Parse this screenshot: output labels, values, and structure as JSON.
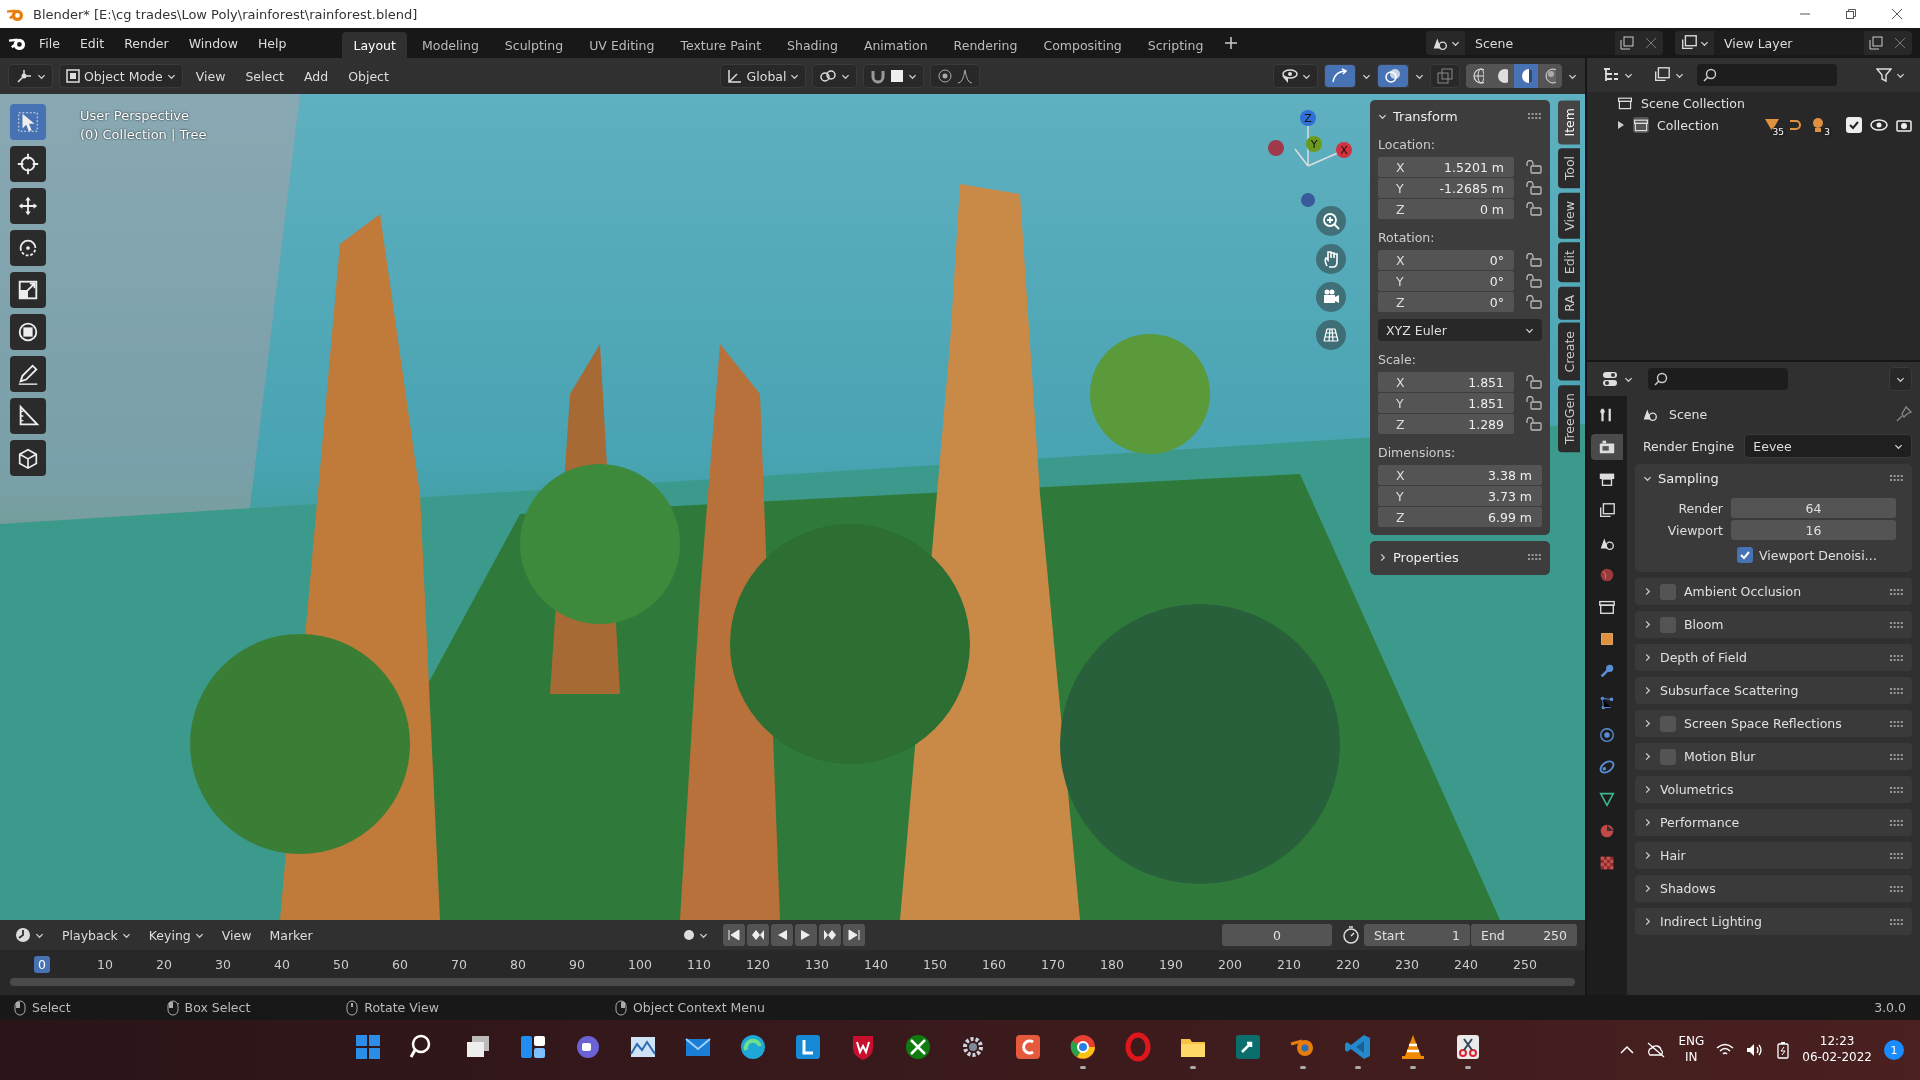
{
  "title_bar": {
    "title": "Blender* [E:\\cg trades\\Low Poly\\rainforest\\rainforest.blend]"
  },
  "menu": [
    "File",
    "Edit",
    "Render",
    "Window",
    "Help"
  ],
  "workspaces": [
    {
      "label": "Layout",
      "selected": true
    },
    {
      "label": "Modeling",
      "selected": false
    },
    {
      "label": "Sculpting",
      "selected": false
    },
    {
      "label": "UV Editing",
      "selected": false
    },
    {
      "label": "Texture Paint",
      "selected": false
    },
    {
      "label": "Shading",
      "selected": false
    },
    {
      "label": "Animation",
      "selected": false
    },
    {
      "label": "Rendering",
      "selected": false
    },
    {
      "label": "Compositing",
      "selected": false
    },
    {
      "label": "Scripting",
      "selected": false
    }
  ],
  "scene": {
    "value": "Scene"
  },
  "view_layer": {
    "value": "View Layer"
  },
  "viewport_header": {
    "mode": "Object Mode",
    "menus": [
      "View",
      "Select",
      "Add",
      "Object"
    ],
    "orientation": "Global",
    "snap": {
      "on": false
    },
    "proportional_edit": {
      "on": false
    },
    "shading": [
      {
        "kind": "wireframe",
        "selected": false
      },
      {
        "kind": "solid",
        "selected": false
      },
      {
        "kind": "material",
        "selected": true
      },
      {
        "kind": "rendered",
        "selected": false
      }
    ]
  },
  "tools": [
    {
      "kind": "select",
      "selected": true
    },
    {
      "kind": "cursor",
      "selected": false
    },
    {
      "kind": "move",
      "selected": false
    },
    {
      "kind": "rotate",
      "selected": false
    },
    {
      "kind": "scale",
      "selected": false
    },
    {
      "kind": "transform",
      "selected": false
    },
    {
      "kind": "annotate",
      "selected": false
    },
    {
      "kind": "measure",
      "selected": false
    },
    {
      "kind": "add_cube",
      "selected": false
    }
  ],
  "viewport": {
    "perspective": "User Perspective",
    "collection": "(0) Collection | Tree",
    "axes": [
      {
        "label": "Z",
        "color": "#2f6fd6"
      },
      {
        "label": "Y",
        "color": "#6a9a1e"
      },
      {
        "label": "X",
        "color": "#d2323f"
      }
    ]
  },
  "sidebar_tabs": [
    {
      "label": "Item",
      "selected": true
    },
    {
      "label": "Tool",
      "selected": false
    },
    {
      "label": "View",
      "selected": false
    },
    {
      "label": "Edit",
      "selected": false
    },
    {
      "label": "RA",
      "selected": false
    },
    {
      "label": "Create",
      "selected": false
    },
    {
      "label": "TreeGen",
      "selected": false
    }
  ],
  "transform": {
    "title": "Transform",
    "expanded": true,
    "groups": [
      {
        "kind": "vector",
        "label": "Location:",
        "fields": [
          {
            "axis": "X",
            "value": "1.5201 m",
            "locked": false
          },
          {
            "axis": "Y",
            "value": "-1.2685 m",
            "locked": false
          },
          {
            "axis": "Z",
            "value": "0 m",
            "locked": false
          }
        ]
      },
      {
        "kind": "vector",
        "label": "Rotation:",
        "fields": [
          {
            "axis": "X",
            "value": "0°",
            "locked": false
          },
          {
            "axis": "Y",
            "value": "0°",
            "locked": false
          },
          {
            "axis": "Z",
            "value": "0°",
            "locked": false
          }
        ]
      },
      {
        "kind": "dropdown",
        "value": "XYZ Euler"
      },
      {
        "kind": "vector",
        "label": "Scale:",
        "fields": [
          {
            "axis": "X",
            "value": "1.851",
            "locked": false
          },
          {
            "axis": "Y",
            "value": "1.851",
            "locked": false
          },
          {
            "axis": "Z",
            "value": "1.289",
            "locked": false
          }
        ]
      },
      {
        "kind": "wide",
        "label": "Dimensions:",
        "fields": [
          {
            "axis": "X",
            "value": "3.38 m"
          },
          {
            "axis": "Y",
            "value": "3.73 m"
          },
          {
            "axis": "Z",
            "value": "6.99 m"
          }
        ]
      }
    ]
  },
  "properties_panel": {
    "title": "Properties",
    "expanded": false
  },
  "outliner": {
    "items": [
      {
        "label": "Scene Collection",
        "children": [
          {
            "label": "Collection",
            "expanded": false,
            "mesh_count": "35",
            "light_count": "3",
            "checked": true
          }
        ]
      }
    ]
  },
  "properties": {
    "context": "Scene",
    "engine_label": "Render Engine",
    "engine": "Eevee",
    "tabs": [
      {
        "kind": "tool",
        "selected": false
      },
      {
        "kind": "render",
        "selected": true
      },
      {
        "kind": "output",
        "selected": false
      },
      {
        "kind": "view_layer",
        "selected": false
      },
      {
        "kind": "scene",
        "selected": false
      },
      {
        "kind": "world",
        "selected": false
      },
      {
        "kind": "collection",
        "selected": false
      },
      {
        "kind": "object",
        "selected": false
      },
      {
        "kind": "modifiers",
        "selected": false
      },
      {
        "kind": "particles",
        "selected": false
      },
      {
        "kind": "physics",
        "selected": false
      },
      {
        "kind": "constraints",
        "selected": false
      },
      {
        "kind": "data",
        "selected": false
      },
      {
        "kind": "material",
        "selected": false
      },
      {
        "kind": "texture",
        "selected": false
      }
    ],
    "sampling": {
      "title": "Sampling",
      "expanded": true,
      "fields": [
        {
          "label": "Render",
          "value": "64"
        },
        {
          "label": "Viewport",
          "value": "16"
        }
      ],
      "denoise": {
        "label": "Viewport Denoisi…",
        "checked": true
      }
    },
    "panels": [
      {
        "label": "Ambient Occlusion",
        "kind": "toggle",
        "checked": false
      },
      {
        "label": "Bloom",
        "kind": "toggle",
        "checked": false
      },
      {
        "label": "Depth of Field",
        "kind": "plain"
      },
      {
        "label": "Subsurface Scattering",
        "kind": "plain"
      },
      {
        "label": "Screen Space Reflections",
        "kind": "toggle",
        "checked": false
      },
      {
        "label": "Motion Blur",
        "kind": "toggle",
        "checked": false
      },
      {
        "label": "Volumetrics",
        "kind": "plain"
      },
      {
        "label": "Performance",
        "kind": "plain"
      },
      {
        "label": "Hair",
        "kind": "plain"
      },
      {
        "label": "Shadows",
        "kind": "plain"
      },
      {
        "label": "Indirect Lighting",
        "kind": "plain"
      }
    ]
  },
  "timeline": {
    "menus": [
      "Playback",
      "Keying",
      "View",
      "Marker"
    ],
    "current_frame": "0",
    "start_label": "Start",
    "start": "1",
    "end_label": "End",
    "end": "250",
    "ticks": [
      {
        "label": "0",
        "selected": true
      },
      {
        "label": "10",
        "selected": false
      },
      {
        "label": "20",
        "selected": false
      },
      {
        "label": "30",
        "selected": false
      },
      {
        "label": "40",
        "selected": false
      },
      {
        "label": "50",
        "selected": false
      },
      {
        "label": "60",
        "selected": false
      },
      {
        "label": "70",
        "selected": false
      },
      {
        "label": "80",
        "selected": false
      },
      {
        "label": "90",
        "selected": false
      },
      {
        "label": "100",
        "selected": false
      },
      {
        "label": "110",
        "selected": false
      },
      {
        "label": "120",
        "selected": false
      },
      {
        "label": "130",
        "selected": false
      },
      {
        "label": "140",
        "selected": false
      },
      {
        "label": "150",
        "selected": false
      },
      {
        "label": "160",
        "selected": false
      },
      {
        "label": "170",
        "selected": false
      },
      {
        "label": "180",
        "selected": false
      },
      {
        "label": "190",
        "selected": false
      },
      {
        "label": "200",
        "selected": false
      },
      {
        "label": "210",
        "selected": false
      },
      {
        "label": "220",
        "selected": false
      },
      {
        "label": "230",
        "selected": false
      },
      {
        "label": "240",
        "selected": false
      },
      {
        "label": "250",
        "selected": false
      }
    ]
  },
  "status_bar": {
    "hints": [
      {
        "kind": "left",
        "label": "Select"
      },
      {
        "kind": "drag",
        "label": "Box Select"
      },
      {
        "kind": "middle",
        "label": "Rotate View"
      },
      {
        "kind": "right",
        "label": "Object Context Menu"
      }
    ],
    "version": "3.0.0"
  },
  "taskbar": {
    "apps": [
      {
        "kind": "start",
        "running": false
      },
      {
        "kind": "search",
        "running": false
      },
      {
        "kind": "taskview",
        "running": false
      },
      {
        "kind": "widgets",
        "running": false
      },
      {
        "kind": "chat",
        "running": false
      },
      {
        "kind": "photos",
        "running": false
      },
      {
        "kind": "mail",
        "running": false
      },
      {
        "kind": "edge",
        "running": false
      },
      {
        "kind": "tile_blue",
        "running": false
      },
      {
        "kind": "shield",
        "running": false
      },
      {
        "kind": "xbox",
        "running": false
      },
      {
        "kind": "settings",
        "running": false
      },
      {
        "kind": "tile_red",
        "running": false
      },
      {
        "kind": "chrome",
        "running": true
      },
      {
        "kind": "opera",
        "running": false
      },
      {
        "kind": "files",
        "running": true
      },
      {
        "kind": "tile_teal",
        "running": false
      },
      {
        "kind": "blender",
        "running": true
      },
      {
        "kind": "vscode",
        "running": true
      },
      {
        "kind": "vlc",
        "running": true
      },
      {
        "kind": "snip",
        "running": true
      }
    ],
    "language": "ENG",
    "region": "IN",
    "time": "12:23",
    "date": "06-02-2022",
    "notifications": "1"
  }
}
